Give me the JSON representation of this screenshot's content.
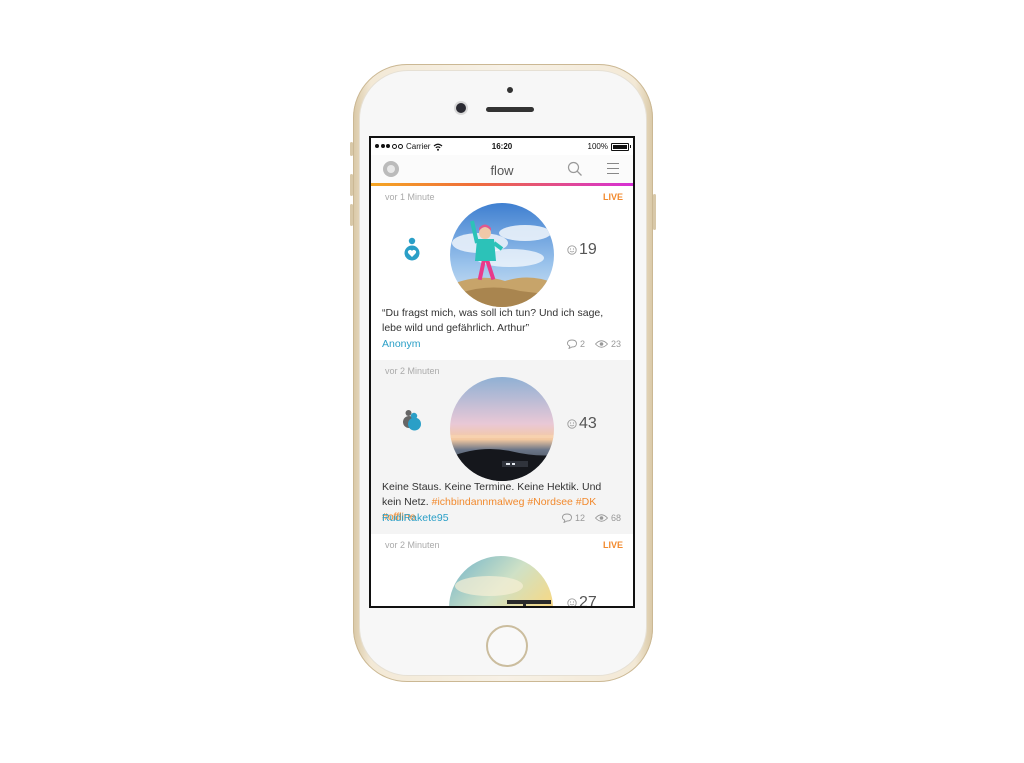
{
  "status_bar": {
    "carrier": "Carrier",
    "time": "16:20",
    "battery": "100%"
  },
  "nav": {
    "title": "flow",
    "logo_icon": "flow-logo-icon",
    "search_icon": "search-icon",
    "menu_icon": "hamburger-menu-icon"
  },
  "colors": {
    "accent": "#f28a2e",
    "link": "#2a9fc7",
    "gradient_start": "#f5a623",
    "gradient_end": "#d62fd6"
  },
  "posts": [
    {
      "time": "vor 1 Minute",
      "badge": "LIVE",
      "likes": "19",
      "text": "“Du fragst mich, was soll ich tun? Und ich sage, lebe wild und gefährlich. Arthur”",
      "author": "Anonym",
      "comments": "2",
      "views": "23"
    },
    {
      "time": "vor 2 Minuten",
      "badge": "",
      "likes": "43",
      "text": "Keine Staus. Keine Termine. Keine Hektik. Und kein Netz.",
      "tags": "#ichbindannmalweg #Nordsee #DK #offline",
      "author": "RudiRakete95",
      "comments": "12",
      "views": "68"
    },
    {
      "time": "vor 2 Minuten",
      "badge": "LIVE",
      "likes": "27"
    }
  ]
}
